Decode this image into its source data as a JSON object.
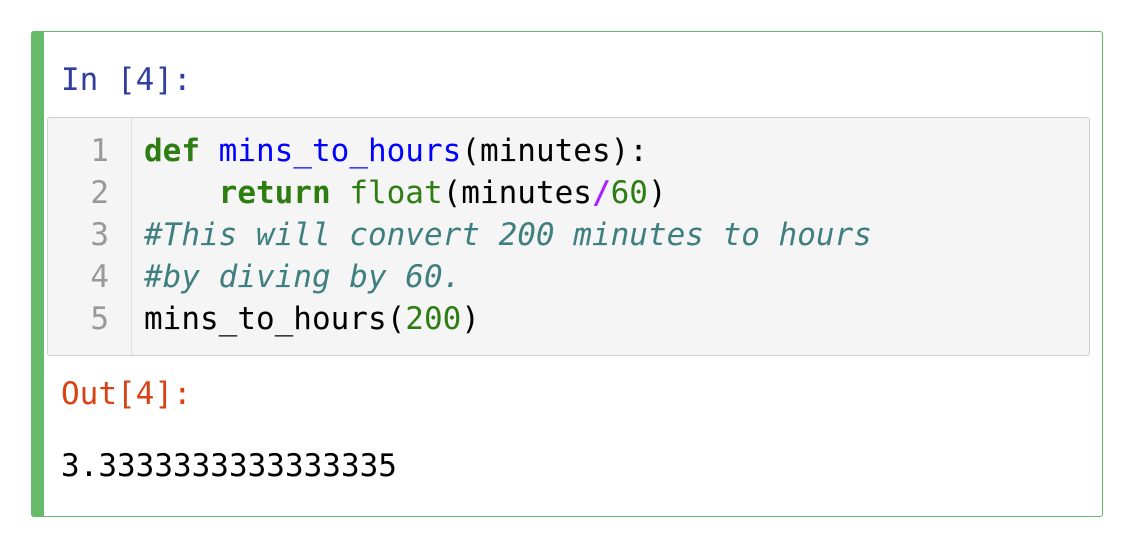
{
  "cell": {
    "in_prompt": "In [4]:",
    "out_prompt": "Out[4]:",
    "output_value": "3.3333333333333335",
    "accent_color": "#66bb6a"
  },
  "editor": {
    "line_numbers": [
      "1",
      "2",
      "3",
      "4",
      "5"
    ],
    "lines": {
      "l1": {
        "kw": "def",
        "sp": " ",
        "fn": "mins_to_hours",
        "rest": "(minutes):"
      },
      "l2": {
        "indent": "    ",
        "kw": "return",
        "sp": " ",
        "builtin": "float",
        "a": "(minutes",
        "op": "/",
        "num": "60",
        "b": ")"
      },
      "l3": {
        "comment": "#This will convert 200 minutes to hours"
      },
      "l4": {
        "comment": "#by diving by 60."
      },
      "l5": {
        "call": "mins_to_hours(",
        "num": "200",
        "close": ")"
      }
    }
  }
}
